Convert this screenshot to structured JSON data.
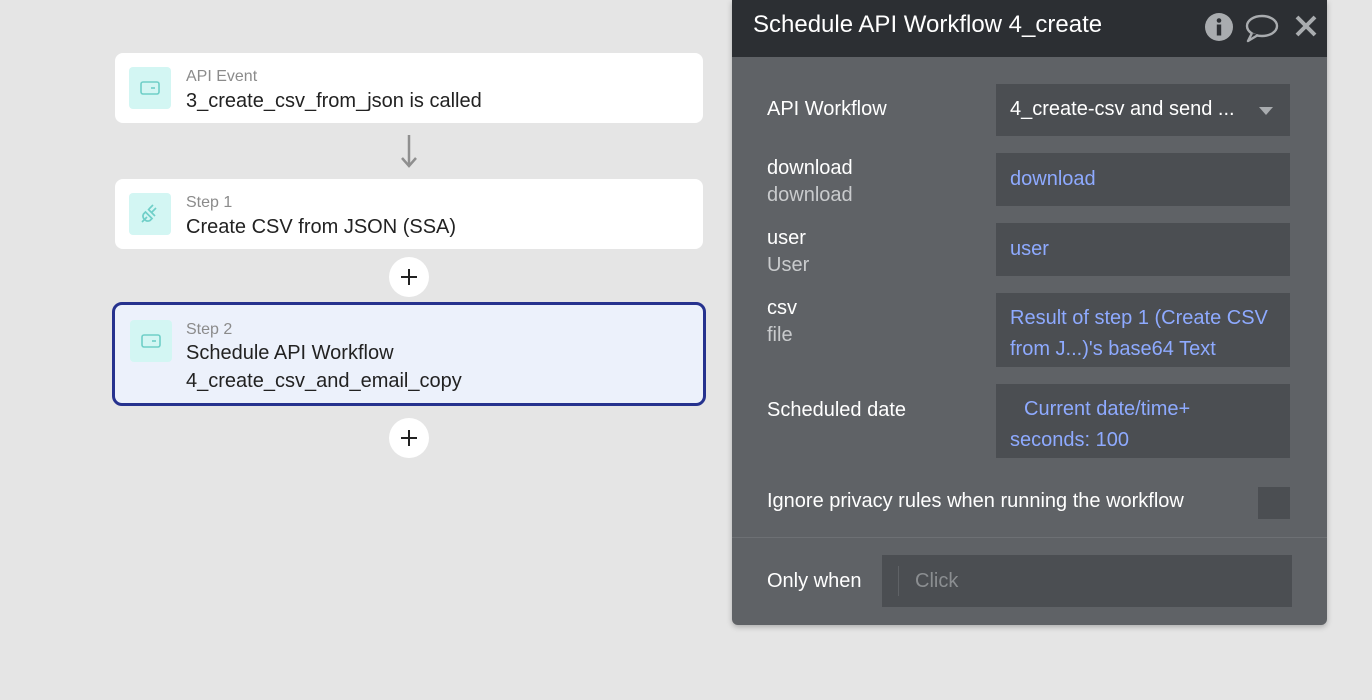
{
  "canvas": {
    "event_card": {
      "kind": "API Event",
      "title": "3_create_csv_from_json is called"
    },
    "step1_card": {
      "kind": "Step 1",
      "title": "Create CSV from JSON (SSA)"
    },
    "step2_card": {
      "kind": "Step 2",
      "title_line1": "Schedule API Workflow",
      "title_line2": "4_create_csv_and_email_copy"
    },
    "icons": {
      "event": "api-event-icon",
      "step1": "plugin-icon",
      "step2": "api-workflow-icon",
      "arrow": "down-arrow-icon",
      "add": "plus-icon"
    }
  },
  "panel": {
    "title": "Schedule API Workflow 4_create",
    "header_icons": [
      "info-icon",
      "comment-icon",
      "close-icon"
    ],
    "api_workflow": {
      "label": "API Workflow",
      "value": "4_create-csv and send ..."
    },
    "params": [
      {
        "name": "download",
        "type": "download",
        "value": "download"
      },
      {
        "name": "user",
        "type": "User",
        "value": "user"
      },
      {
        "name": "csv",
        "type": "file",
        "value_line1": "Result of step 1 (Create CSV",
        "value_line2": "from J...)'s base64 Text"
      }
    ],
    "scheduled_date": {
      "label": "Scheduled date",
      "value_line1": "Current date/time+",
      "value_line2": "seconds: 100"
    },
    "ignore_privacy": {
      "label": "Ignore privacy rules when running the workflow",
      "checked": false
    },
    "only_when": {
      "label": "Only when",
      "placeholder": "Click"
    }
  },
  "colors": {
    "accent_border": "#26328e",
    "link_text": "#8eaaff",
    "panel_bg": "#5f6266",
    "header_bg": "#2c2f33",
    "icon_bg": "#d3f6f3"
  }
}
